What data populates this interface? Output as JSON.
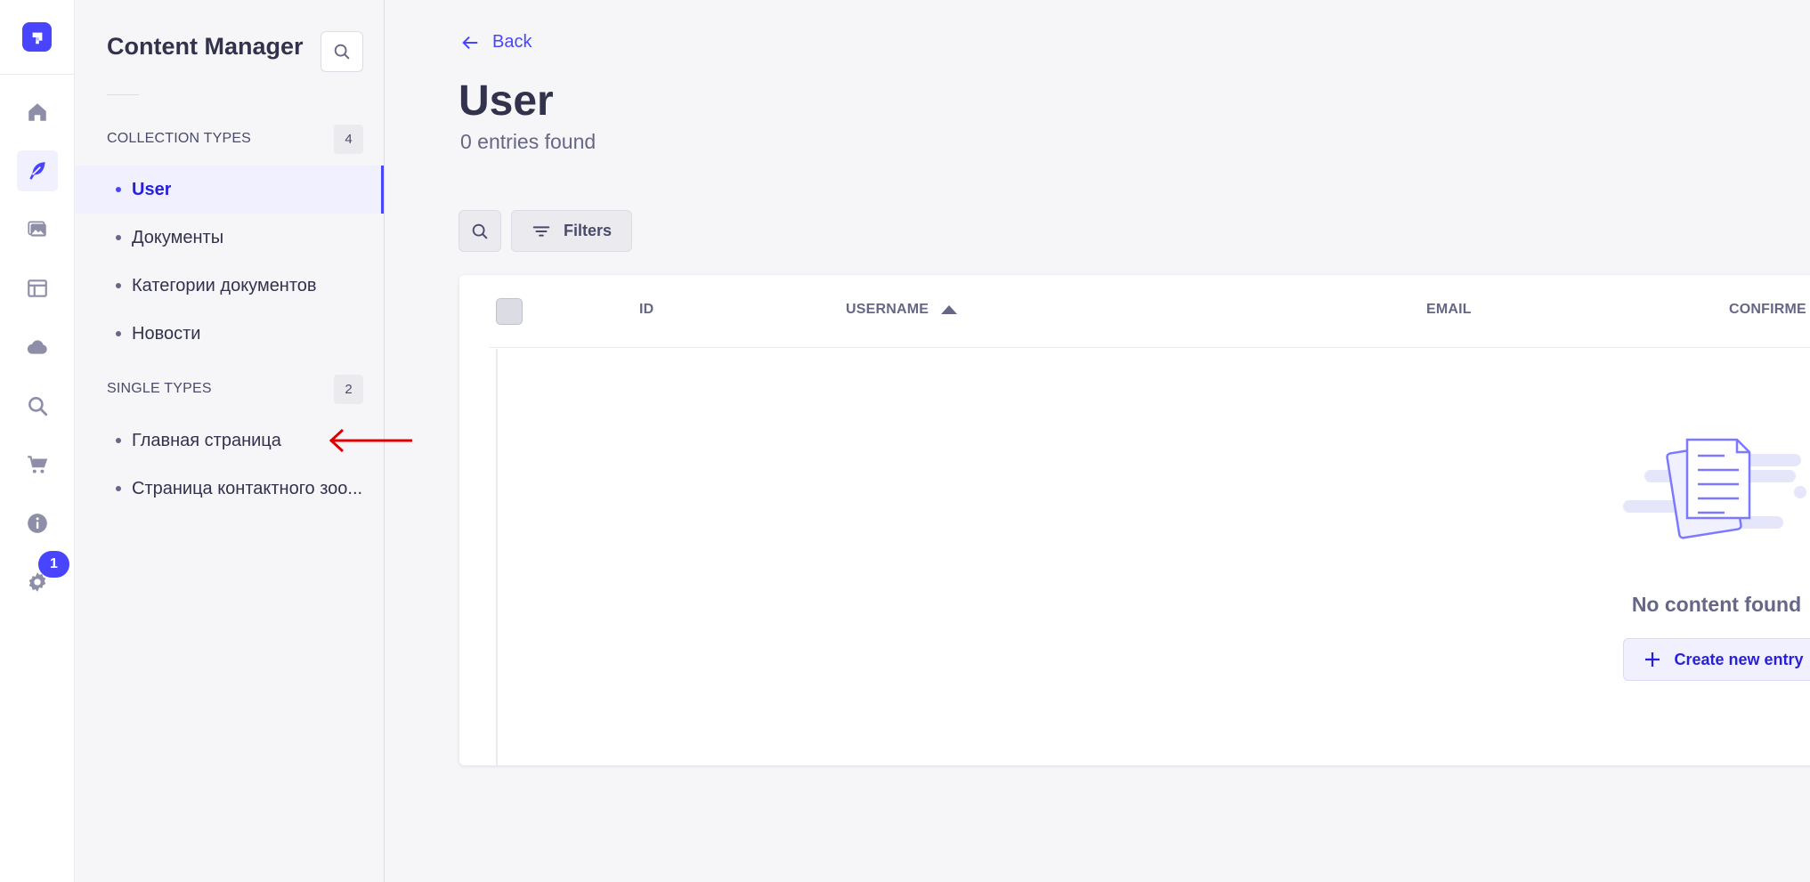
{
  "sidebar": {
    "title": "Content Manager",
    "collection_label": "COLLECTION TYPES",
    "collection_count": "4",
    "collection_items": [
      "User",
      "Документы",
      "Категории документов",
      "Новости"
    ],
    "single_label": "SINGLE TYPES",
    "single_count": "2",
    "single_items": [
      "Главная страница",
      "Страница контактного зоо..."
    ]
  },
  "rail": {
    "icons": [
      "home-icon",
      "feather-icon",
      "media-icon",
      "layout-icon",
      "cloud-icon",
      "search-icon",
      "cart-icon",
      "info-icon",
      "gear-icon"
    ],
    "settings_badge": "1"
  },
  "main": {
    "back_label": "Back",
    "title": "User",
    "subtitle": "0 entries found",
    "filters_label": "Filters",
    "columns": [
      "ID",
      "USERNAME",
      "EMAIL",
      "CONFIRME"
    ],
    "empty_text": "No content found",
    "create_label": "Create new entry"
  },
  "colors": {
    "accent": "#4945ff",
    "annotation_arrow": "#e00000"
  }
}
